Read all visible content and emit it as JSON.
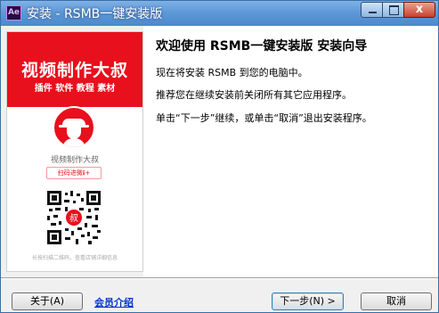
{
  "window": {
    "icon_label": "Ae",
    "title": "安装 - RSMB一键安装版",
    "controls": {
      "minimize": "",
      "maximize": "",
      "close": "x"
    }
  },
  "banner": {
    "title": "视频制作大叔",
    "subtitle": "插件 软件 教程 素材",
    "brand_name": "视频制作大叔",
    "scan_button": "扫码进微ℹ+",
    "qr_center": "叔",
    "qr_tip": "长按扫描二维码，查看店铺详细信息"
  },
  "main": {
    "heading": "欢迎使用 RSMB一键安装版 安装向导",
    "line1": "现在将安装 RSMB 到您的电脑中。",
    "line2": "推荐您在继续安装前关闭所有其它应用程序。",
    "line3": "单击“下一步”继续，或单击“取消”退出安装程序。"
  },
  "footer": {
    "about_button": "关于(A)",
    "member_link": "会员介绍",
    "next_button": "下一步(N) >",
    "cancel_button": "取消"
  },
  "colors": {
    "banner_red": "#e8101c",
    "titlebar": "#5e99d8",
    "link": "#0033cc"
  }
}
